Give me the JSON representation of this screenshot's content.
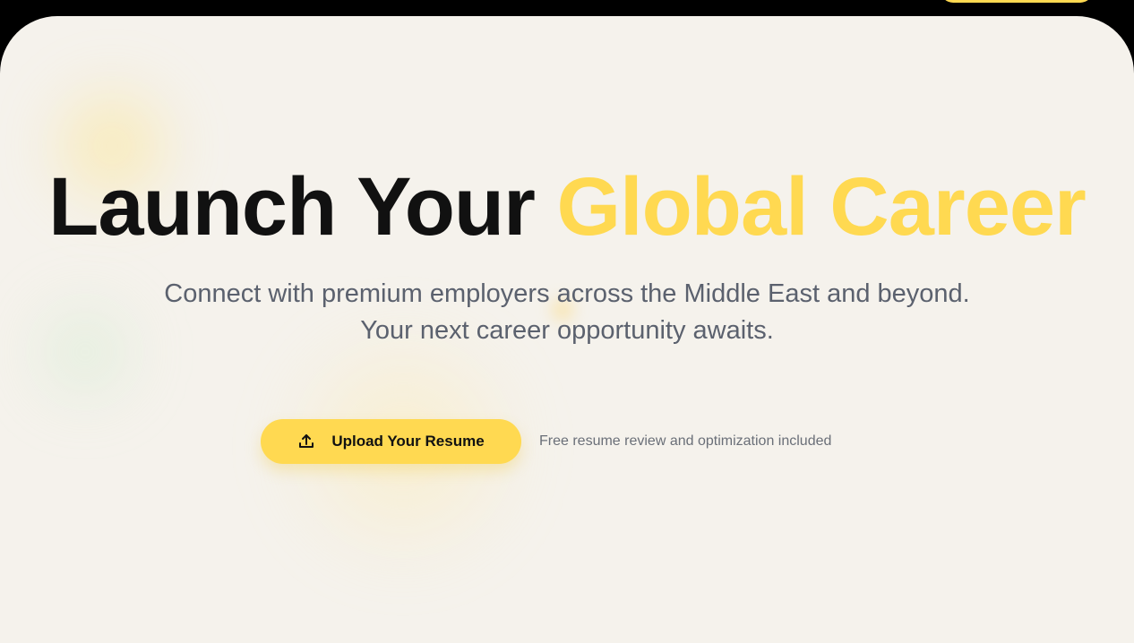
{
  "hero": {
    "headline_part1": "Launch Your",
    "headline_accent": "Global Career",
    "subtitle_line1": "Connect with premium employers across the Middle East and beyond.",
    "subtitle_line2": "Your next career opportunity awaits.",
    "cta_label": "Upload Your Resume",
    "cta_icon": "upload-icon",
    "cta_note": "Free resume review and optimization included"
  },
  "colors": {
    "accent": "#FFD951",
    "background": "#F5F2EC",
    "frame": "#000000",
    "headline": "#111111",
    "subtitle": "#5B616E"
  }
}
